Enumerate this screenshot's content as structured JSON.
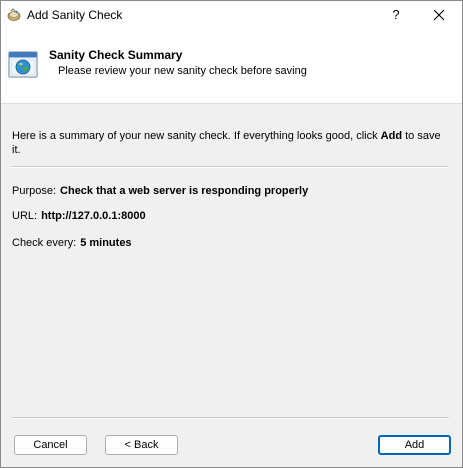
{
  "window": {
    "title": "Add Sanity Check",
    "help_label": "?"
  },
  "header": {
    "title": "Sanity Check Summary",
    "subtitle": "Please review your new sanity check before saving"
  },
  "intro": {
    "before": "Here is a summary of your new sanity check. If everything looks good, click ",
    "action": "Add",
    "after": " to save it."
  },
  "summary": {
    "purpose_label": "Purpose:",
    "purpose_value": "Check that a web server is responding properly",
    "url_label": "URL:",
    "url_value": "http://127.0.0.1:8000",
    "interval_label": "Check every:",
    "interval_value": "5 minutes"
  },
  "buttons": {
    "cancel": "Cancel",
    "back": "< Back",
    "add": "Add"
  },
  "colors": {
    "accent": "#0067c0",
    "window_bg": "#f0f0f0",
    "header_bg": "#ffffff"
  }
}
